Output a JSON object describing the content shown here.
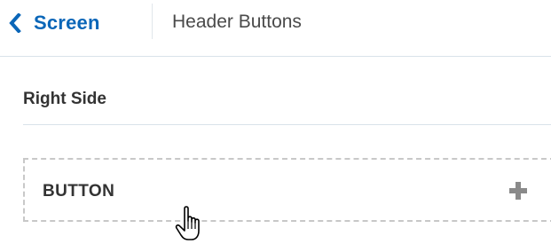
{
  "header": {
    "back_label": "Screen",
    "title": "Header Buttons",
    "back_icon": "chevron-left-icon",
    "accent_color": "#0a66b8"
  },
  "section": {
    "title": "Right Side"
  },
  "button_zone": {
    "label": "BUTTON",
    "add_icon": "plus-icon"
  },
  "cursor": {
    "icon": "hand-pointer-icon"
  }
}
